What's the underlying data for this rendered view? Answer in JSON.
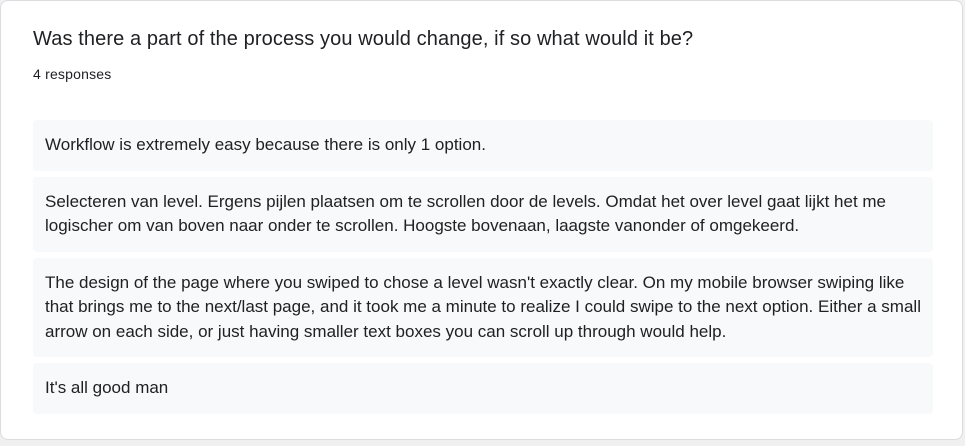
{
  "question": {
    "title": "Was there a part of the process you would change, if so what would it be?",
    "response_count": "4 responses"
  },
  "responses": [
    "Workflow is extremely easy because there is only 1 option.",
    "Selecteren van level. Ergens pijlen plaatsen om te scrollen door de levels. Omdat het over level gaat lijkt het me logischer om van boven naar onder te scrollen. Hoogste bovenaan, laagste vanonder of omgekeerd.",
    "The design of the page where you swiped to chose a level wasn't exactly clear. On my mobile browser swiping like that brings me to the next/last page, and it took me a minute to realize I could swipe to the next option. Either a small arrow on each side, or just having smaller text boxes you can scroll up through would help.",
    "It's all good man"
  ]
}
